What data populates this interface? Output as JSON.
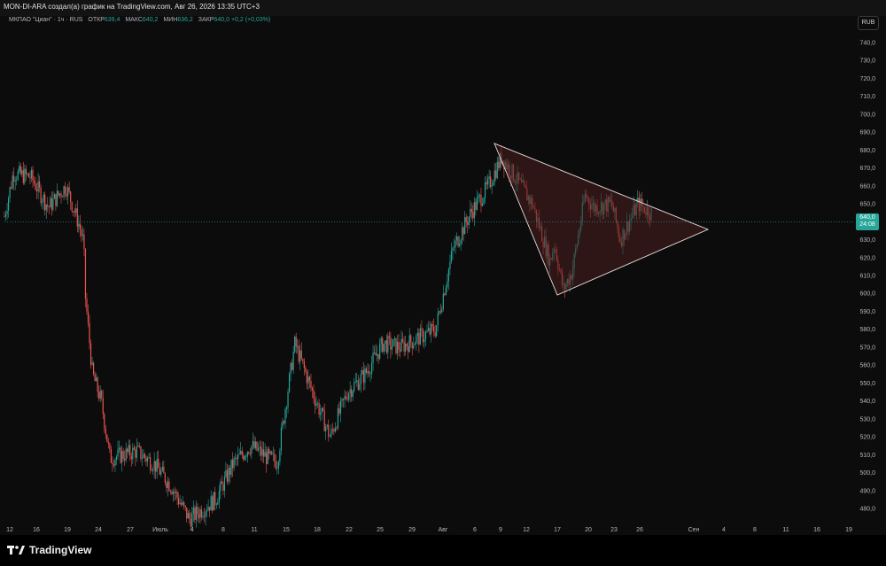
{
  "header": {
    "title": "MON-DI-ARA создал(а) график на TradingView.com, Авг 26, 2026 13:35 UTC+3"
  },
  "legend": {
    "symbol": "МКПАО \"Циан\" · 1ч · RUS",
    "open_label": "ОТКР",
    "open": "639,4",
    "high_label": "МАКС",
    "high": "640,2",
    "low_label": "МИН",
    "low": "636,2",
    "close_label": "ЗАКР",
    "close": "640,0",
    "change": "+0,2 (+0,03%)"
  },
  "currency_button": "RUB",
  "current_price": {
    "value": "640,0",
    "countdown": "24:08"
  },
  "brand": "TradingView",
  "colors": {
    "up": "#26a69a",
    "down": "#ef5350",
    "triangle_fill": "#4a1f1f",
    "triangle_line": "#e8dcdc"
  },
  "chart_data": {
    "type": "candlestick",
    "y_axis_labels": [
      "740,0",
      "730,0",
      "720,0",
      "710,0",
      "700,0",
      "690,0",
      "680,0",
      "670,0",
      "660,0",
      "650,0",
      "640,0",
      "630,0",
      "620,0",
      "610,0",
      "600,0",
      "590,0",
      "580,0",
      "570,0",
      "560,0",
      "550,0",
      "540,0",
      "530,0",
      "520,0",
      "510,0",
      "500,0",
      "490,0",
      "480,0"
    ],
    "ylim": [
      474,
      746
    ],
    "x_axis_labels": [
      "12",
      "16",
      "19",
      "24",
      "27",
      "Июль",
      "4",
      "8",
      "11",
      "15",
      "18",
      "22",
      "25",
      "29",
      "Авг",
      "6",
      "9",
      "12",
      "17",
      "20",
      "23",
      "26",
      "Сен",
      "4",
      "8",
      "11",
      "16",
      "19"
    ],
    "price_path": [
      [
        0,
        643
      ],
      [
        0.01,
        667
      ],
      [
        0.03,
        665
      ],
      [
        0.05,
        648
      ],
      [
        0.07,
        660
      ],
      [
        0.085,
        638
      ],
      [
        0.09,
        628
      ],
      [
        0.092,
        598
      ],
      [
        0.1,
        555
      ],
      [
        0.11,
        540
      ],
      [
        0.12,
        508
      ],
      [
        0.15,
        512
      ],
      [
        0.17,
        505
      ],
      [
        0.19,
        492
      ],
      [
        0.21,
        474
      ],
      [
        0.24,
        485
      ],
      [
        0.26,
        505
      ],
      [
        0.28,
        515
      ],
      [
        0.3,
        508
      ],
      [
        0.31,
        506
      ],
      [
        0.33,
        572
      ],
      [
        0.35,
        545
      ],
      [
        0.37,
        520
      ],
      [
        0.39,
        545
      ],
      [
        0.41,
        555
      ],
      [
        0.43,
        572
      ],
      [
        0.45,
        570
      ],
      [
        0.47,
        575
      ],
      [
        0.49,
        580
      ],
      [
        0.51,
        625
      ],
      [
        0.53,
        645
      ],
      [
        0.55,
        660
      ],
      [
        0.565,
        676
      ],
      [
        0.58,
        665
      ],
      [
        0.6,
        650
      ],
      [
        0.62,
        618
      ],
      [
        0.625,
        628
      ],
      [
        0.635,
        602
      ],
      [
        0.645,
        612
      ],
      [
        0.66,
        655
      ],
      [
        0.67,
        648
      ],
      [
        0.69,
        650
      ],
      [
        0.7,
        630
      ],
      [
        0.72,
        650
      ],
      [
        0.735,
        645
      ]
    ],
    "triangle": {
      "apex_top": [
        "Авг 9",
        684
      ],
      "apex_bottom": [
        "Авг 17",
        600
      ],
      "apex_right": [
        "Сен 3",
        638
      ]
    },
    "last_price": 640.0
  }
}
